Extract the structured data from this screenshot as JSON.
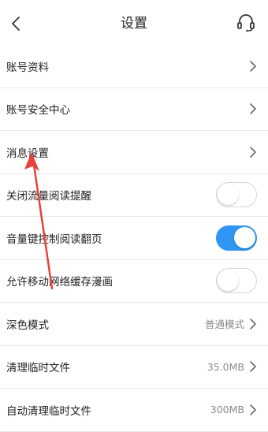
{
  "header": {
    "title": "设置",
    "back_icon": "chevron-left-icon",
    "support_icon": "headset-icon"
  },
  "settings": {
    "account_profile": {
      "label": "账号资料"
    },
    "account_security": {
      "label": "账号安全中心"
    },
    "message_settings": {
      "label": "消息设置"
    },
    "data_reading_reminder": {
      "label": "关闭流量阅读提醒",
      "enabled": false
    },
    "volume_key_page_turn": {
      "label": "音量键控制阅读翻页",
      "enabled": true
    },
    "mobile_network_cache": {
      "label": "允许移动网络缓存漫画",
      "enabled": false
    },
    "dark_mode": {
      "label": "深色模式",
      "value": "普通模式"
    },
    "clear_temp_files": {
      "label": "清理临时文件",
      "value": "35.0MB"
    },
    "auto_clear_temp_files": {
      "label": "自动清理临时文件",
      "value": "300MB"
    }
  },
  "colors": {
    "toggle_on": "#2f96f3",
    "annotation_arrow": "#e8413c"
  }
}
